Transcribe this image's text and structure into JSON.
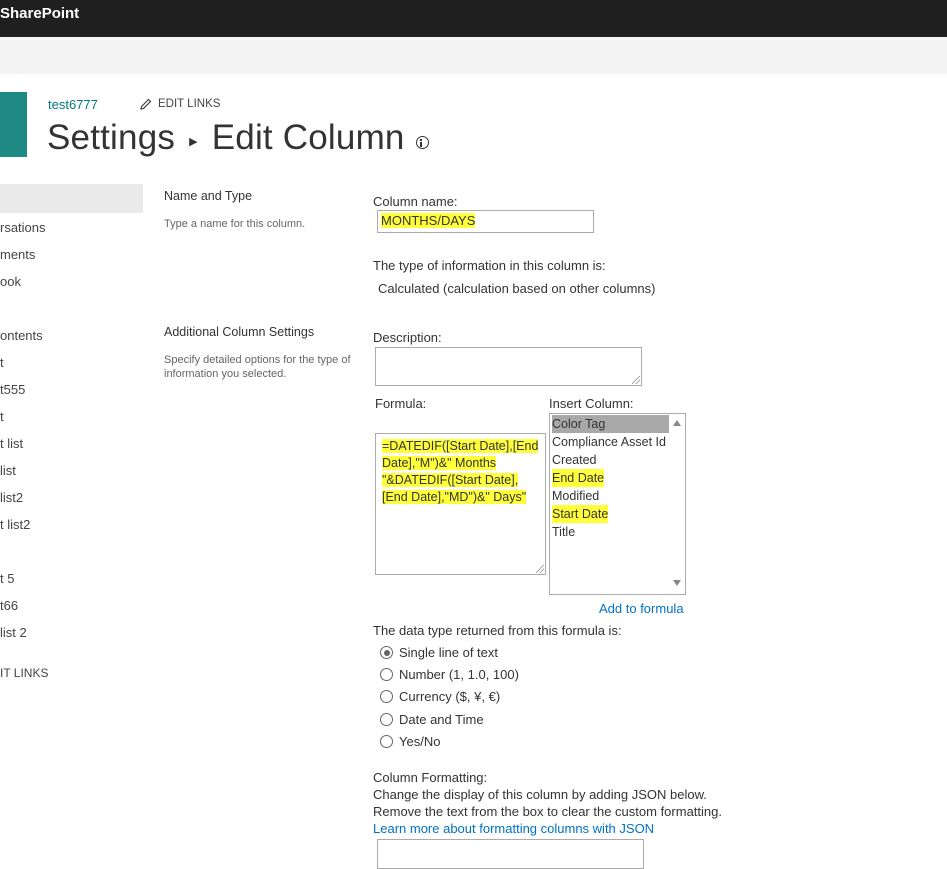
{
  "suite_bar": {
    "title": "SharePoint"
  },
  "site": {
    "link": "test6777",
    "edit_links": "EDIT LINKS"
  },
  "page": {
    "breadcrumb_parent": "Settings",
    "breadcrumb_current": "Edit Column"
  },
  "left_nav": {
    "items": [
      "rsations",
      "ments",
      "ook",
      "ontents",
      "t",
      "t555",
      "t",
      "t list",
      "list",
      "list2",
      "t list2",
      "t 5",
      "t66",
      "list 2"
    ],
    "edit_links": "IT LINKS"
  },
  "sections": {
    "name_type": {
      "title": "Name and Type",
      "desc": "Type a name for this column."
    },
    "additional": {
      "title": "Additional Column Settings",
      "desc": "Specify detailed options for the type of information you selected."
    }
  },
  "form": {
    "column_name_label": "Column name:",
    "column_name_value": "MONTHS/DAYS",
    "type_info_label": "The type of information in this column is:",
    "type_info_value": "Calculated (calculation based on other columns)",
    "description_label": "Description:",
    "formula_label": "Formula:",
    "formula_lines": [
      "=DATEDIF([Start Date],[End",
      "Date],\"M\")&\" Months",
      "\"&DATEDIF([Start Date],",
      "[End Date],\"MD\")&\" Days\""
    ],
    "insert_column_label": "Insert Column:",
    "insert_columns": [
      "Color Tag",
      "Compliance Asset Id",
      "Created",
      "End Date",
      "Modified",
      "Start Date",
      "Title"
    ],
    "add_to_formula": "Add to formula",
    "return_type_label": "The data type returned from this formula is:",
    "return_types": [
      "Single line of text",
      "Number (1, 1.0, 100)",
      "Currency ($, ¥, €)",
      "Date and Time",
      "Yes/No"
    ],
    "selected_return_type": "Single line of text",
    "formatting_label": "Column Formatting:",
    "formatting_desc_1": "Change the display of this column by adding JSON below.",
    "formatting_desc_2": "Remove the text from the box to clear the custom formatting.",
    "formatting_link": "Learn more about formatting columns with JSON"
  },
  "colors": {
    "accent": "#03787c",
    "link": "#0072c6",
    "highlight": "#ffff3a",
    "suite_bar": "#1f1f1f"
  }
}
